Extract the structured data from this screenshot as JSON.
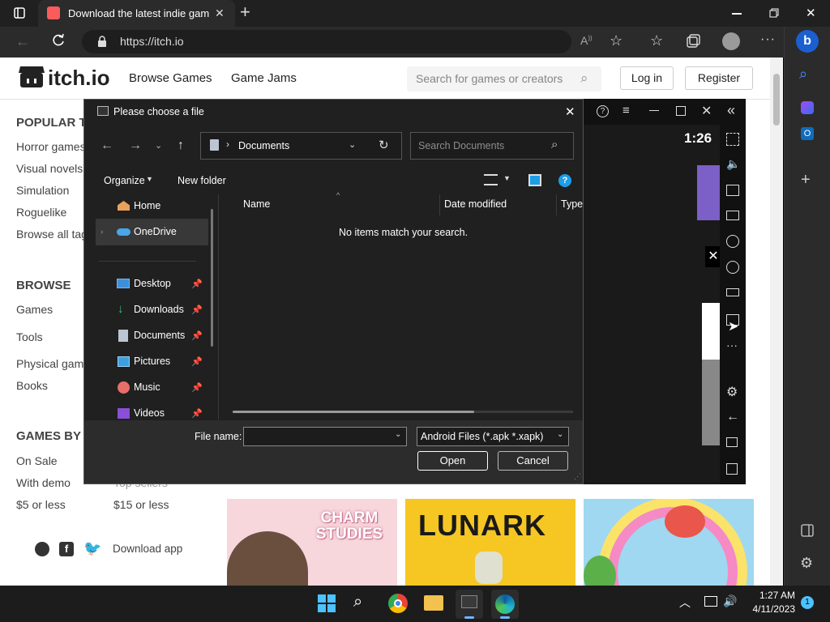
{
  "browser": {
    "tab_title": "Download the latest indie games",
    "url": "https://itch.io"
  },
  "site": {
    "logo_text": "itch.io",
    "nav": [
      "Browse Games",
      "Game Jams"
    ],
    "search_placeholder": "Search for games or creators",
    "login": "Log in",
    "register": "Register",
    "popular_heading": "POPULAR T",
    "popular_items": [
      "Horror games",
      "Visual novels",
      "Simulation",
      "Roguelike",
      "Browse all tag"
    ],
    "browse_heading": "BROWSE",
    "browse_items": [
      "Games",
      "Tools",
      "Physical game",
      "Books"
    ],
    "games_by_heading": "GAMES BY P",
    "price_left": [
      "On Sale",
      "With demo",
      "$5 or less"
    ],
    "price_right": [
      "Top sellers",
      "$15 or less"
    ],
    "download_app": "Download app",
    "cards": [
      {
        "title": "CHARM STUDIES",
        "bg": "#f7d6dc"
      },
      {
        "title": "LUNARK",
        "bg": "#f6c623"
      },
      {
        "title": "",
        "bg": "#9fd8f0"
      }
    ]
  },
  "dialog": {
    "title": "Please choose a file",
    "path": "Documents",
    "search_placeholder": "Search Documents",
    "organize": "Organize",
    "new_folder": "New folder",
    "nav_items": [
      {
        "label": "Home",
        "icon": "home-icon"
      },
      {
        "label": "OneDrive",
        "icon": "cloud-icon"
      },
      {
        "label": "Desktop",
        "icon": "desktop-icon"
      },
      {
        "label": "Downloads",
        "icon": "download-icon"
      },
      {
        "label": "Documents",
        "icon": "document-icon"
      },
      {
        "label": "Pictures",
        "icon": "pictures-icon"
      },
      {
        "label": "Music",
        "icon": "music-icon"
      },
      {
        "label": "Videos",
        "icon": "videos-icon"
      }
    ],
    "columns": [
      "Name",
      "Date modified",
      "Type"
    ],
    "empty_message": "No items match your search.",
    "file_name_label": "File name:",
    "file_name_value": "",
    "filter": "Android Files (*.apk *.xapk)",
    "open": "Open",
    "cancel": "Cancel"
  },
  "emulator": {
    "time": "1:26"
  },
  "taskbar": {
    "time": "1:27 AM",
    "date": "4/11/2023",
    "notification_count": "1"
  }
}
